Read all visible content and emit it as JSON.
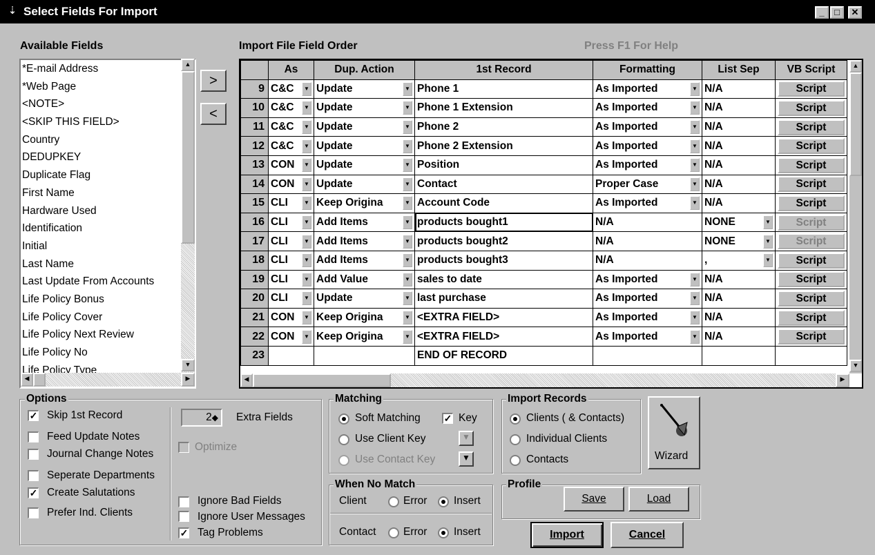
{
  "window": {
    "title": "Select Fields For Import",
    "app_icon": "import-icon",
    "min_glyph": "_",
    "max_glyph": "□",
    "close_glyph": "✕"
  },
  "available_fields": {
    "label": "Available Fields",
    "items": [
      "*E-mail Address",
      "*Web Page",
      "<NOTE>",
      "<SKIP THIS FIELD>",
      "Country",
      "DEDUPKEY",
      "Duplicate Flag",
      "First Name",
      "Hardware Used",
      "Identification",
      "Initial",
      "Last Name",
      "Last Update From Accounts",
      "Life Policy Bonus",
      "Life Policy Cover",
      "Life Policy Next Review",
      "Life Policy No",
      "Life Policy Type"
    ]
  },
  "move_buttons": {
    "add": ">",
    "remove": "<"
  },
  "import_order": {
    "label": "Import File Field Order",
    "help_text": "Press F1 For Help",
    "columns": [
      "As",
      "Dup. Action",
      "1st Record",
      "Formatting",
      "List Sep",
      "VB Script"
    ],
    "rows": [
      {
        "n": "9",
        "as": "C&C",
        "dup": "Update",
        "first": "Phone 1",
        "fmt": "As Imported",
        "sep": "N/A",
        "script": "Script"
      },
      {
        "n": "10",
        "as": "C&C",
        "dup": "Update",
        "first": "Phone 1 Extension",
        "fmt": "As Imported",
        "sep": "N/A",
        "script": "Script"
      },
      {
        "n": "11",
        "as": "C&C",
        "dup": "Update",
        "first": "Phone 2",
        "fmt": "As Imported",
        "sep": "N/A",
        "script": "Script"
      },
      {
        "n": "12",
        "as": "C&C",
        "dup": "Update",
        "first": "Phone 2 Extension",
        "fmt": "As Imported",
        "sep": "N/A",
        "script": "Script"
      },
      {
        "n": "13",
        "as": "CON",
        "dup": "Update",
        "first": "Position",
        "fmt": "As Imported",
        "sep": "N/A",
        "script": "Script"
      },
      {
        "n": "14",
        "as": "CON",
        "dup": "Update",
        "first": "Contact",
        "fmt": "Proper Case",
        "sep": "N/A",
        "script": "Script"
      },
      {
        "n": "15",
        "as": "CLI",
        "dup": "Keep Origina",
        "first": "Account Code",
        "fmt": "As Imported",
        "sep": "N/A",
        "script": "Script"
      },
      {
        "n": "16",
        "as": "CLI",
        "dup": "Add Items",
        "first": "products bought1",
        "fmt": "N/A",
        "sep": "NONE",
        "script": "Script"
      },
      {
        "n": "17",
        "as": "CLI",
        "dup": "Add Items",
        "first": "products bought2",
        "fmt": "N/A",
        "sep": "NONE",
        "script": "Script"
      },
      {
        "n": "18",
        "as": "CLI",
        "dup": "Add Items",
        "first": "products bought3",
        "fmt": "N/A",
        "sep": ",",
        "script": "Script"
      },
      {
        "n": "19",
        "as": "CLI",
        "dup": "Add Value",
        "first": "sales to date",
        "fmt": "As Imported",
        "sep": "N/A",
        "script": "Script"
      },
      {
        "n": "20",
        "as": "CLI",
        "dup": "Update",
        "first": "last purchase",
        "fmt": "As Imported",
        "sep": "N/A",
        "script": "Script"
      },
      {
        "n": "21",
        "as": "CON",
        "dup": "Keep Origina",
        "first": "<EXTRA FIELD>",
        "fmt": "As Imported",
        "sep": "N/A",
        "script": "Script"
      },
      {
        "n": "22",
        "as": "CON",
        "dup": "Keep Origina",
        "first": "<EXTRA FIELD>",
        "fmt": "As Imported",
        "sep": "N/A",
        "script": "Script"
      },
      {
        "n": "23",
        "as": "",
        "dup": "",
        "first": "END OF RECORD",
        "fmt": "",
        "sep": "",
        "script": ""
      }
    ]
  },
  "options": {
    "label": "Options",
    "checks": [
      {
        "label": "Skip 1st Record",
        "checked": true
      },
      {
        "label": "Feed Update Notes",
        "checked": false
      },
      {
        "label": "Journal Change Notes",
        "checked": false
      },
      {
        "label": "Seperate Departments",
        "checked": false
      },
      {
        "label": "Create Salutations",
        "checked": true
      },
      {
        "label": "Prefer Ind. Clients",
        "checked": false
      }
    ],
    "extra_fields_value": "2",
    "extra_fields_label": "Extra Fields",
    "optimize_label": "Optimize",
    "ignore_bad_fields": "Ignore Bad Fields",
    "ignore_user_messages": "Ignore User Messages",
    "tag_problems": "Tag Problems"
  },
  "matching": {
    "label": "Matching",
    "soft": "Soft Matching",
    "key": "Key",
    "client_key": "Use Client Key",
    "contact_key": "Use Contact Key"
  },
  "no_match": {
    "label": "When No Match",
    "client": "Client",
    "contact": "Contact",
    "error": "Error",
    "insert": "Insert"
  },
  "import_records": {
    "label": "Import Records",
    "clients_contacts": "Clients ( & Contacts)",
    "individual": "Individual Clients",
    "contacts": "Contacts"
  },
  "wizard": {
    "label": "Wizard",
    "icon": "wizard-wand-icon"
  },
  "profile": {
    "label": "Profile",
    "save": "Save",
    "load": "Load"
  },
  "actions": {
    "import": "Import",
    "cancel": "Cancel"
  }
}
